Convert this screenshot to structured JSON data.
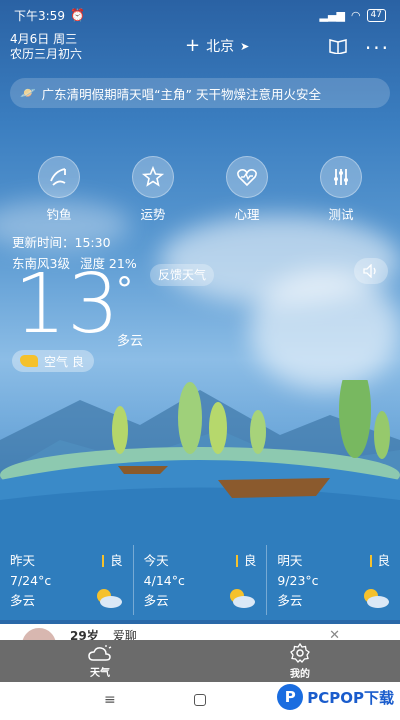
{
  "status_bar": {
    "time": "下午3:59",
    "battery": "47"
  },
  "header": {
    "date": "4月6日 周三",
    "lunar": "农历三月初六",
    "city": "北京"
  },
  "notice": {
    "text": "广东清明假期晴天唱“主角” 天干物燥注意用火安全"
  },
  "tools": [
    {
      "label": "钓鱼",
      "icon": "fishing-icon"
    },
    {
      "label": "运势",
      "icon": "fortune-star-icon"
    },
    {
      "label": "心理",
      "icon": "heart-pulse-icon"
    },
    {
      "label": "测试",
      "icon": "sliders-icon"
    }
  ],
  "current": {
    "update_time": "更新时间：15:30",
    "wind": "东南风3级",
    "humidity": "湿度 21%",
    "feedback": "反馈天气",
    "temp": "13",
    "deg": "°",
    "condition": "多云",
    "aqi": "空气 良"
  },
  "forecast": [
    {
      "day": "昨天",
      "range": "7/24°c",
      "cond": "多云",
      "quality": "良"
    },
    {
      "day": "今天",
      "range": "4/14°c",
      "cond": "多云",
      "quality": "良"
    },
    {
      "day": "明天",
      "range": "9/23°c",
      "cond": "多云",
      "quality": "良"
    }
  ],
  "ad": {
    "age": "29岁",
    "text": "爱聊"
  },
  "tabs": [
    {
      "label": "天气",
      "icon": "weather-icon"
    },
    {
      "label": "我的",
      "icon": "settings-icon"
    }
  ],
  "watermark": {
    "brand": "PCPOP下载"
  },
  "colors": {
    "accent": "#f5c12c",
    "tabbar": "#6b6b6b",
    "sky": "#2a62a4"
  }
}
